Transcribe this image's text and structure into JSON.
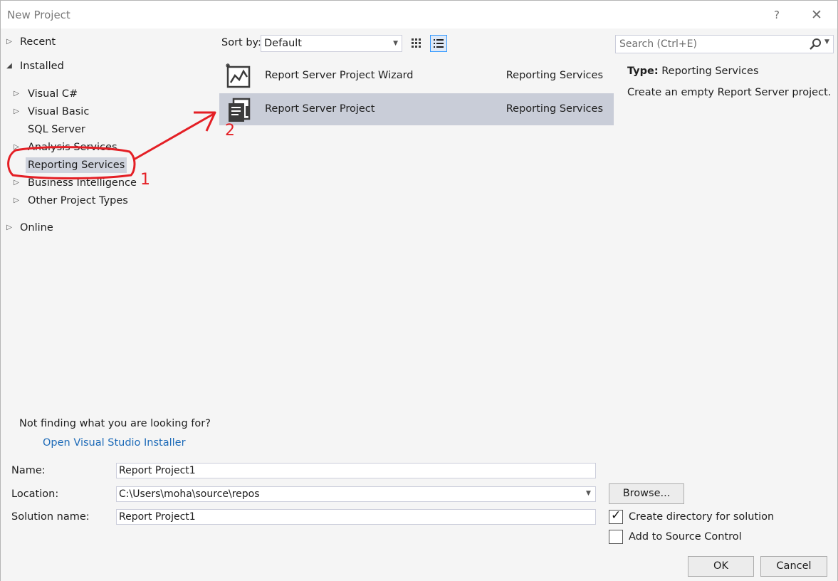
{
  "window": {
    "title": "New Project",
    "help_glyph": "?",
    "close_glyph": "✕"
  },
  "tree": {
    "recent": "Recent",
    "installed": "Installed",
    "visual_csharp": "Visual C#",
    "visual_basic": "Visual Basic",
    "sql_server": "SQL Server",
    "analysis_services": "Analysis Services",
    "reporting_services": "Reporting Services",
    "business_intelligence": "Business Intelligence",
    "other_project_types": "Other Project Types",
    "online": "Online"
  },
  "left_footer": {
    "question": "Not finding what you are looking for?",
    "link": "Open Visual Studio Installer"
  },
  "toolbar": {
    "sort_label": "Sort by:",
    "sort_value": "Default"
  },
  "templates": [
    {
      "name": "Report Server Project Wizard",
      "category": "Reporting Services",
      "icon": "report-wizard-icon"
    },
    {
      "name": "Report Server Project",
      "category": "Reporting Services",
      "icon": "report-project-icon"
    }
  ],
  "search": {
    "placeholder": "Search (Ctrl+E)"
  },
  "details": {
    "type_label": "Type:",
    "type_value": "Reporting Services",
    "description": "Create an empty Report Server project."
  },
  "form": {
    "name_label": "Name:",
    "name_value": "Report Project1",
    "location_label": "Location:",
    "location_value": "C:\\Users\\moha\\source\\repos",
    "solution_label": "Solution name:",
    "solution_value": "Report Project1",
    "browse_label": "Browse...",
    "create_dir_label": "Create directory for solution",
    "create_dir_checked": true,
    "source_control_label": "Add to Source Control",
    "source_control_checked": false,
    "ok_label": "OK",
    "cancel_label": "Cancel"
  },
  "annotations": {
    "step1": "1",
    "step2": "2",
    "color": "#e41f25"
  }
}
